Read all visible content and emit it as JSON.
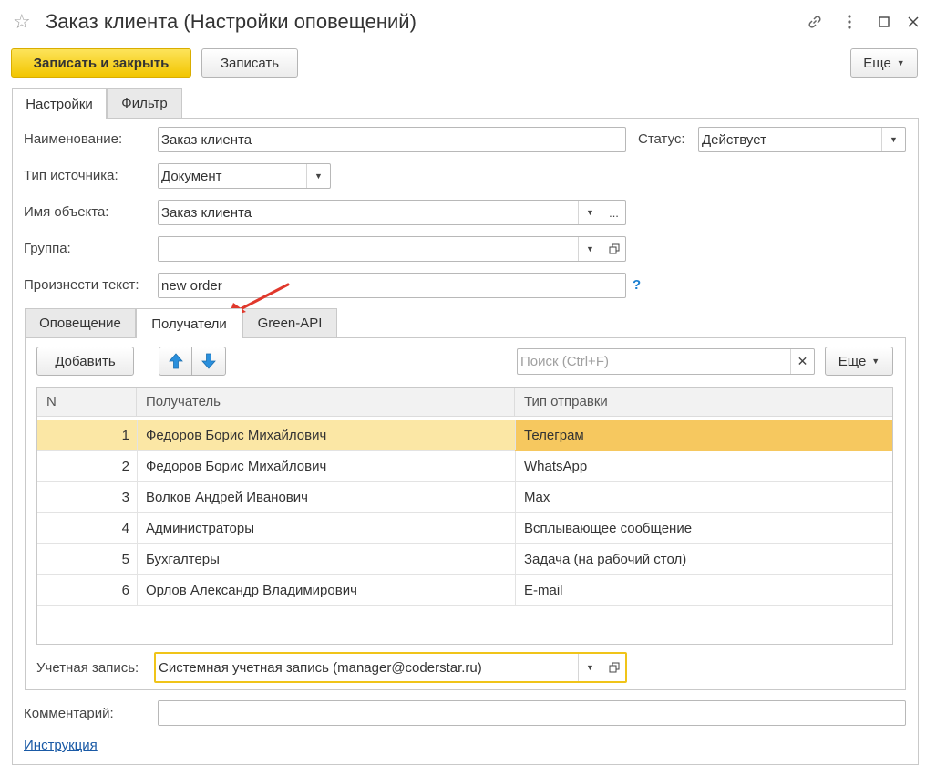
{
  "window": {
    "title": "Заказ клиента (Настройки оповещений)"
  },
  "toolbar": {
    "save_close": "Записать и закрыть",
    "save": "Записать",
    "more": "Еще"
  },
  "main_tabs": [
    {
      "label": "Настройки",
      "active": true
    },
    {
      "label": "Фильтр",
      "active": false
    }
  ],
  "form": {
    "name_label": "Наименование:",
    "name_value": "Заказ клиента",
    "status_label": "Статус:",
    "status_value": "Действует",
    "source_type_label": "Тип источника:",
    "source_type_value": "Документ",
    "object_label": "Имя объекта:",
    "object_value": "Заказ клиента",
    "group_label": "Группа:",
    "group_value": "",
    "speak_label": "Произнести текст:",
    "speak_value": "new order",
    "help": "?"
  },
  "inner_tabs": [
    {
      "label": "Оповещение",
      "active": false
    },
    {
      "label": "Получатели",
      "active": true
    },
    {
      "label": "Green-API",
      "active": false
    }
  ],
  "recipients": {
    "add": "Добавить",
    "search_placeholder": "Поиск (Ctrl+F)",
    "more": "Еще",
    "columns": [
      "N",
      "Получатель",
      "Тип отправки"
    ],
    "rows": [
      {
        "n": "1",
        "recipient": "Федоров Борис Михайлович",
        "type": "Телеграм",
        "selected": true
      },
      {
        "n": "2",
        "recipient": "Федоров Борис Михайлович",
        "type": "WhatsApp",
        "selected": false
      },
      {
        "n": "3",
        "recipient": "Волков Андрей Иванович",
        "type": "Max",
        "selected": false
      },
      {
        "n": "4",
        "recipient": "Администраторы",
        "type": "Всплывающее сообщение",
        "selected": false
      },
      {
        "n": "5",
        "recipient": "Бухгалтеры",
        "type": "Задача (на рабочий стол)",
        "selected": false
      },
      {
        "n": "6",
        "recipient": "Орлов Александр Владимирович",
        "type": "E-mail",
        "selected": false
      }
    ],
    "account_label": "Учетная запись:",
    "account_value": "Системная учетная запись (manager@coderstar.ru)"
  },
  "comment_label": "Комментарий:",
  "comment_value": "",
  "instruction_link": "Инструкция",
  "colors": {
    "accent": "#f2c600",
    "selected_row": "#fbe7a5",
    "selected_cell": "#f6c85f",
    "arrow": "#e0382c",
    "link": "#1a5aa6"
  }
}
